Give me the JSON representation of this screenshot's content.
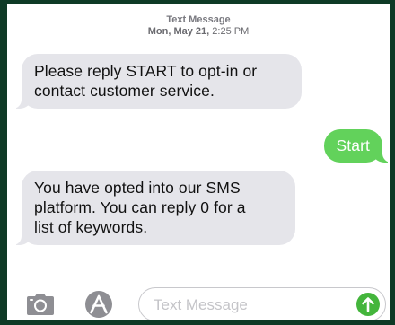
{
  "header": {
    "kind": "Text Message",
    "date": "Mon, May 21,",
    "time": "2:25 PM"
  },
  "messages": [
    {
      "direction": "incoming",
      "text": "Please reply START to opt-in or\ncontact customer service."
    },
    {
      "direction": "outgoing",
      "text": "Start"
    },
    {
      "direction": "incoming",
      "text": "You have opted into our SMS\nplatform. You can reply 0 for a\nlist of keywords."
    }
  ],
  "composer": {
    "placeholder": "Text Message",
    "icons": [
      "camera-icon",
      "app-store-icon",
      "send-arrow-icon"
    ]
  },
  "colors": {
    "incoming_bubble": "#e5e5ea",
    "outgoing_bubble": "#62d25b",
    "send_button": "#44b53c",
    "frame": "#0e3a26"
  }
}
